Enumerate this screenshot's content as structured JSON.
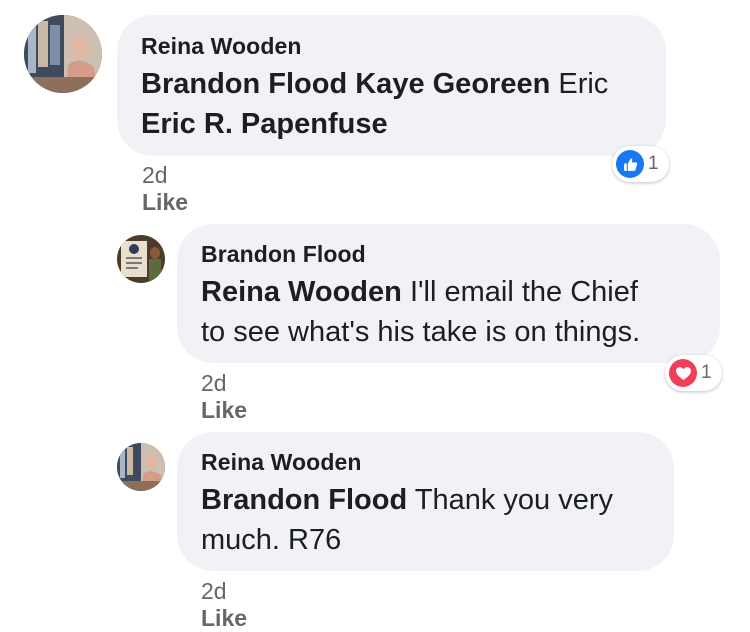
{
  "accent_like": "#1877f2",
  "accent_love": "#f33e58",
  "comments": [
    {
      "author": "Reina Wooden",
      "mentions": [
        "Brandon Flood Kaye Georeen",
        "Eric R. Papenfuse"
      ],
      "text_plain": "Eric",
      "time": "2d",
      "like_label": "Like",
      "reaction": {
        "icon": "like-icon",
        "count": "1"
      }
    },
    {
      "author": "Brandon Flood",
      "mention": "Reina Wooden",
      "text_plain": "I'll email the Chief",
      "text_plain_2": "to see what's his take is on things.",
      "time": "2d",
      "like_label": "Like",
      "reaction": {
        "icon": "love-icon",
        "count": "1"
      }
    },
    {
      "author": "Reina Wooden",
      "mention": "Brandon Flood",
      "text_plain": "Thank you very",
      "text_plain_2": "much. R76",
      "time": "2d",
      "like_label": "Like"
    }
  ]
}
